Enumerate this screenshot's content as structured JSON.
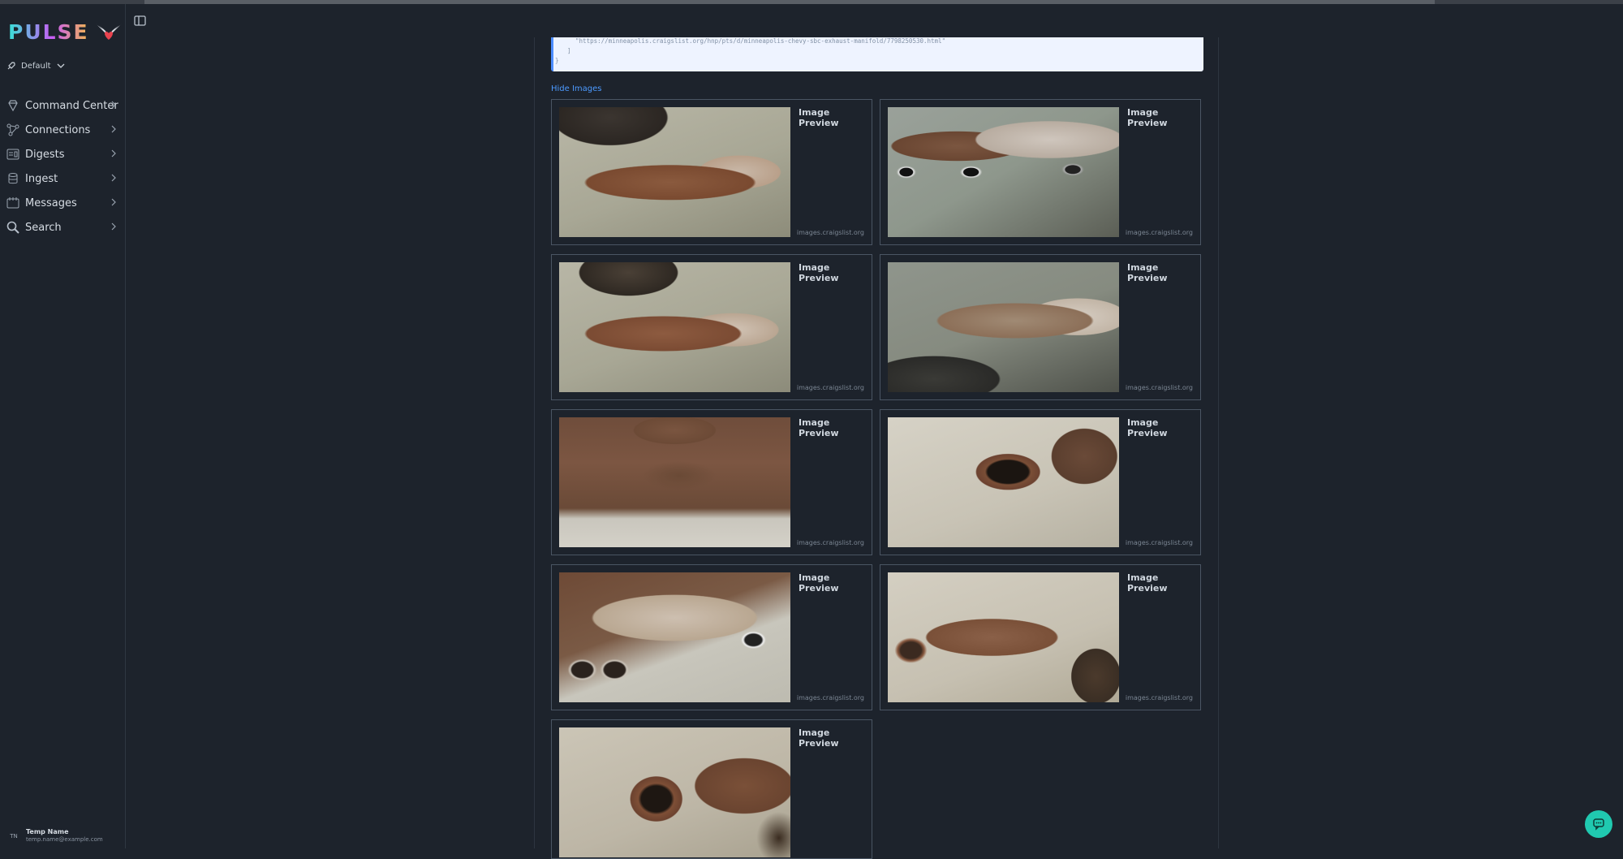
{
  "app": {
    "logo_text": "PULSE",
    "accent": "#36e1d6"
  },
  "sidebar": {
    "profile_label": "Default",
    "items": [
      {
        "label": "Command Center",
        "icon": "diamond-icon"
      },
      {
        "label": "Connections",
        "icon": "connections-icon"
      },
      {
        "label": "Digests",
        "icon": "digest-icon"
      },
      {
        "label": "Ingest",
        "icon": "database-icon"
      },
      {
        "label": "Messages",
        "icon": "messages-icon"
      },
      {
        "label": "Search",
        "icon": "search-icon"
      }
    ],
    "user": {
      "initials": "TN",
      "name": "Temp Name",
      "email": "temp.name@example.com"
    }
  },
  "code": {
    "lines": [
      "  \"https://minneapolis.craigslist.org/hnp/pts/d/minneapolis-chevy-sbc-exhaust-manifold/7798250530.html\"",
      "  ]",
      "}"
    ]
  },
  "images": {
    "toggle_label": "Hide Images",
    "cards": [
      {
        "title": "Image Preview",
        "source": "images.craigslist.org"
      },
      {
        "title": "Image Preview",
        "source": "images.craigslist.org"
      },
      {
        "title": "Image Preview",
        "source": "images.craigslist.org"
      },
      {
        "title": "Image Preview",
        "source": "images.craigslist.org"
      },
      {
        "title": "Image Preview",
        "source": "images.craigslist.org"
      },
      {
        "title": "Image Preview",
        "source": "images.craigslist.org"
      },
      {
        "title": "Image Preview",
        "source": "images.craigslist.org"
      },
      {
        "title": "Image Preview",
        "source": "images.craigslist.org"
      },
      {
        "title": "Image Preview",
        "source": ""
      }
    ]
  }
}
